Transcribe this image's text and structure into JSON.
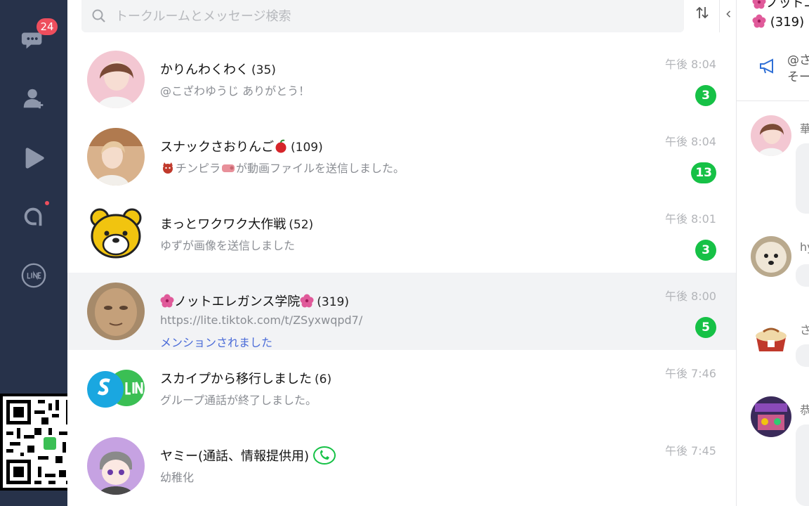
{
  "rail": {
    "items": [
      {
        "name": "chats",
        "icon": "chat-bubbles-icon",
        "badge": "24"
      },
      {
        "name": "add-friend",
        "icon": "add-friend-icon"
      },
      {
        "name": "voom",
        "icon": "voom-play-icon"
      },
      {
        "name": "openchat",
        "icon": "openchat-icon"
      },
      {
        "name": "line",
        "icon": "line-logo-icon"
      }
    ]
  },
  "search": {
    "placeholder": "トークルームとメッセージ検索"
  },
  "chats": [
    {
      "title": "かりんわくわく",
      "count": "(35)",
      "preview": "@こざわゆうじ ありがとう！",
      "time": "午後 8:04",
      "unread": "3"
    },
    {
      "title": "スナックさおりんご",
      "count": "(109)",
      "preview": "チンピラ",
      "preview_suffix": "が動画ファイルを送信しました。",
      "time": "午後 8:04",
      "unread": "13"
    },
    {
      "title": "まっとワクワク大作戦",
      "count": "(52)",
      "preview": "ゆずが画像を送信しました",
      "time": "午後 8:01",
      "unread": "3"
    },
    {
      "title": "ノットエレガンス学院",
      "count": "(319)",
      "preview": "https://lite.tiktok.com/t/ZSyxwqpd7/",
      "mention": "メンションされました",
      "time": "午後 8:00",
      "unread": "5"
    },
    {
      "title": "スカイプから移行しました",
      "count": "(6)",
      "preview": "グループ通話が終了しました。",
      "time": "午後 7:46"
    },
    {
      "title": "ヤミー(通話、情報提供用)",
      "preview": "幼稚化",
      "time": "午後 7:45"
    }
  ],
  "panel": {
    "title": "ノットエ",
    "count": "(319)",
    "announcement": [
      "@さ",
      "そーう"
    ],
    "messages": [
      {
        "name": "華"
      },
      {
        "name": "hy"
      },
      {
        "name": "さ"
      },
      {
        "name": "恭"
      }
    ]
  },
  "colors": {
    "rail": "#27324a",
    "badge": "#ee4e5d",
    "unread": "#16c146",
    "mention": "#4a6bd8",
    "selected_row": "#f2f3f5"
  }
}
